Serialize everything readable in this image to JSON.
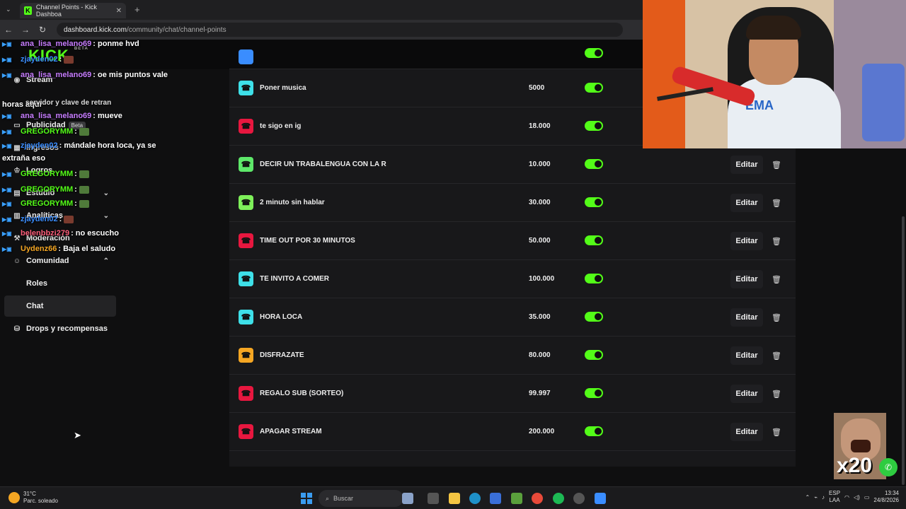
{
  "browser": {
    "tab_title": "Channel Points - Kick Dashboa",
    "url_host": "dashboard.kick.com",
    "url_path": "/community/chat/channel-points"
  },
  "sidebar": {
    "logo": "KICK",
    "logo_sub": "BETA",
    "items": [
      {
        "label": "Stream",
        "icon": "broadcast-icon"
      },
      {
        "label": "Publicidad",
        "badge": "Beta",
        "icon": "ad-icon"
      },
      {
        "label": "Ingresos",
        "icon": "income-icon"
      },
      {
        "label": "Logros",
        "icon": "trophy-icon"
      },
      {
        "label": "Estudio",
        "icon": "studio-icon"
      },
      {
        "label": "Analíticas",
        "icon": "analytics-icon"
      },
      {
        "label": "Moderación",
        "icon": "moderation-icon"
      },
      {
        "label": "Comunidad",
        "icon": "community-icon"
      }
    ],
    "subitems": [
      {
        "label": "Roles"
      },
      {
        "label": "Chat"
      }
    ],
    "drops": {
      "label": "Drops y recompensas",
      "icon": "gift-icon"
    }
  },
  "chat_overlay": [
    {
      "user": "ana_lisa_melano69",
      "color": "#c77dff",
      "text": ": ponme hvd"
    },
    {
      "user": "zjayden02",
      "color": "#3a8dff",
      "text": ":"
    },
    {
      "user": "ana_lisa_melano69",
      "color": "#c77dff",
      "text": ": oe mis puntos vale"
    },
    {
      "user": "",
      "color": "#fff",
      "text": "horas aquí"
    },
    {
      "user": "ana_lisa_melano69",
      "color": "#c77dff",
      "text": ": mueve"
    },
    {
      "user": "GREGORYMM",
      "color": "#53fc18",
      "text": ":"
    },
    {
      "user": "zjayden02",
      "color": "#3a8dff",
      "text": ": mándale hora loca, ya se"
    },
    {
      "user": "",
      "color": "#fff",
      "text": "extraña eso"
    },
    {
      "user": "GREGORYMM",
      "color": "#53fc18",
      "text": ":"
    },
    {
      "user": "GREGORYMM",
      "color": "#53fc18",
      "text": ":"
    },
    {
      "user": "GREGORYMM",
      "color": "#53fc18",
      "text": ":"
    },
    {
      "user": "zjayden02",
      "color": "#3a8dff",
      "text": ":"
    },
    {
      "user": "belenbbzi279",
      "color": "#ff5e7a",
      "text": ": no escucho"
    },
    {
      "user": "Uydenz66",
      "color": "#f5a623",
      "text": ": Baja el saludo"
    }
  ],
  "chat_overlay_extra": "servidor y clave de retran",
  "rewards": [
    {
      "name": "Poner musica",
      "cost": "5000",
      "color": "#3ee0e8"
    },
    {
      "name": "te sigo en ig",
      "cost": "18.000",
      "color": "#e8173f"
    },
    {
      "name": "DECIR UN TRABALENGUA CON LA R",
      "cost": "10.000",
      "color": "#5ee86a"
    },
    {
      "name": "2 minuto sin hablar",
      "cost": "30.000",
      "color": "#7ef05a"
    },
    {
      "name": "TIME OUT POR 30 MINUTOS",
      "cost": "50.000",
      "color": "#e8173f"
    },
    {
      "name": "TE INVITO A COMER",
      "cost": "100.000",
      "color": "#3ee0e8"
    },
    {
      "name": "HORA LOCA",
      "cost": "35.000",
      "color": "#3ee0e8"
    },
    {
      "name": "DISFRAZATE",
      "cost": "80.000",
      "color": "#f5a623"
    },
    {
      "name": "REGALO SUB (SORTEO)",
      "cost": "99.997",
      "color": "#e8173f"
    },
    {
      "name": "APAGAR STREAM",
      "cost": "200.000",
      "color": "#e8173f"
    }
  ],
  "reward_actions": {
    "edit_label": "Editar"
  },
  "webcam": {
    "shirt_text": "EMA"
  },
  "emote": {
    "text": "x20"
  },
  "taskbar": {
    "temp": "31°C",
    "weather": "Parc. soleado",
    "search_placeholder": "Buscar",
    "lang1": "ESP",
    "lang2": "LAA",
    "time": "13:34",
    "date": "24/8/2026"
  }
}
